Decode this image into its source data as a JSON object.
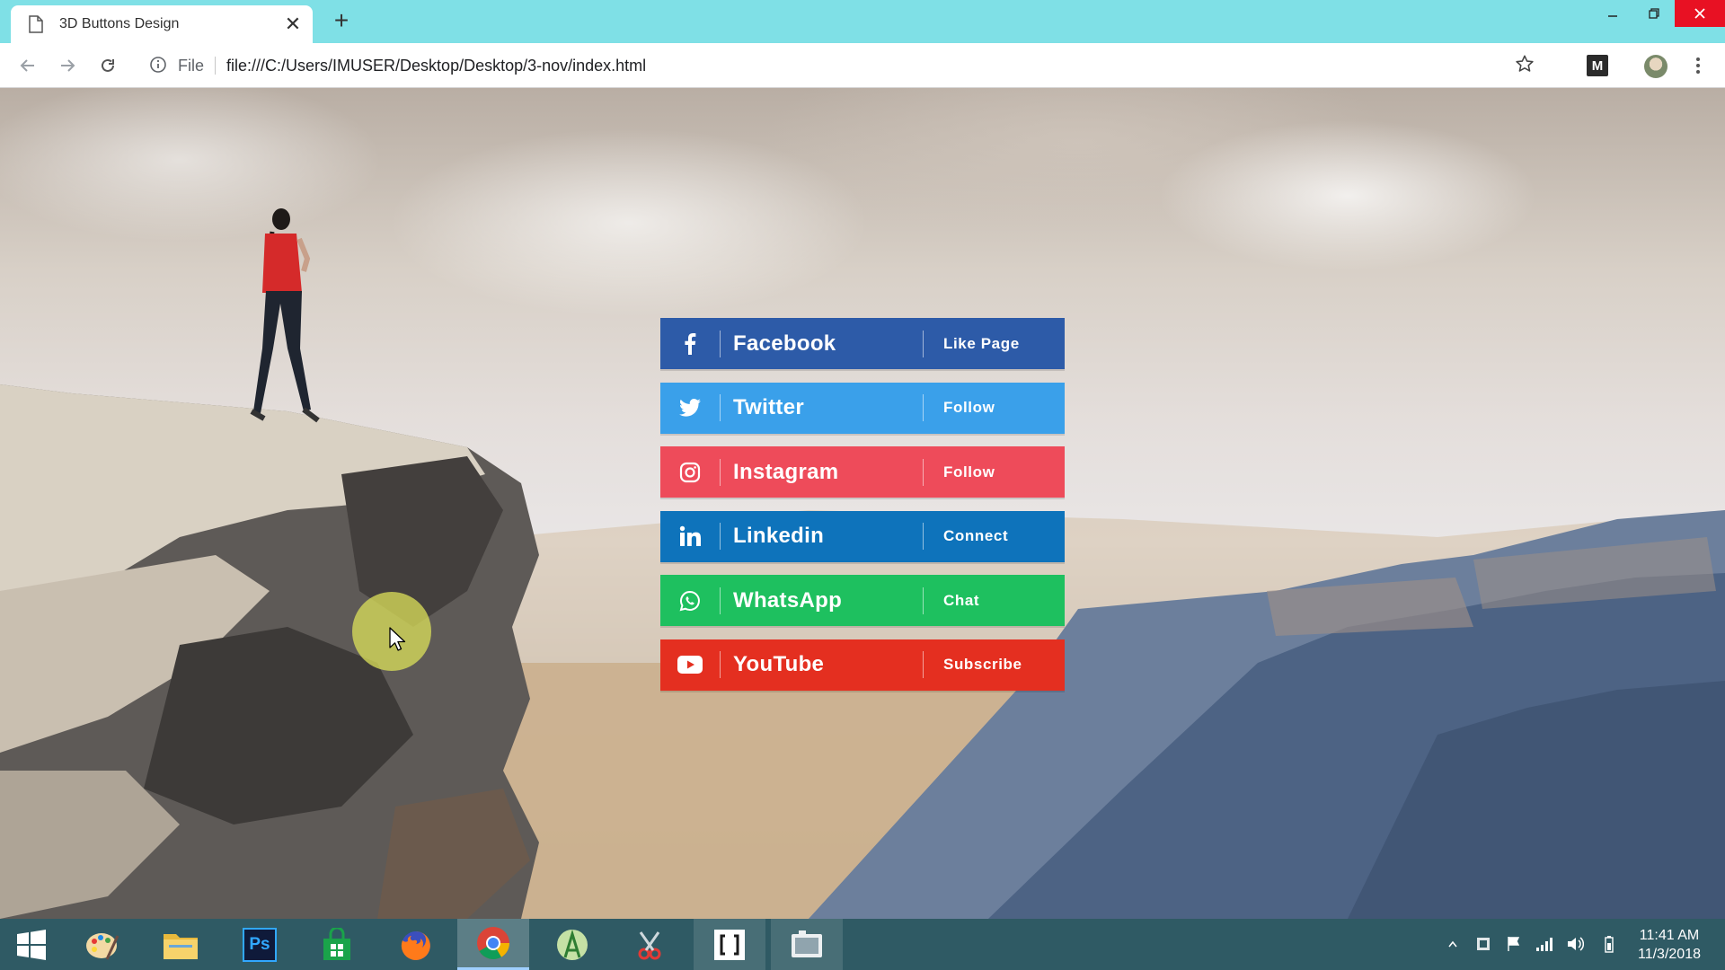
{
  "browser": {
    "tab_title": "3D Buttons Design",
    "tab_close": "✕",
    "new_tab": "+",
    "scheme_label": "File",
    "url": "file:///C:/Users/IMUSER/Desktop/Desktop/3-nov/index.html",
    "extension_label": "M"
  },
  "social_buttons": [
    {
      "icon": "facebook-icon",
      "name": "Facebook",
      "action": "Like Page",
      "color": "#2d5ba8"
    },
    {
      "icon": "twitter-icon",
      "name": "Twitter",
      "action": "Follow",
      "color": "#3aa0ea"
    },
    {
      "icon": "instagram-icon",
      "name": "Instagram",
      "action": "Follow",
      "color": "#ee4b5a"
    },
    {
      "icon": "linkedin-icon",
      "name": "Linkedin",
      "action": "Connect",
      "color": "#0e73bb"
    },
    {
      "icon": "whatsapp-icon",
      "name": "WhatsApp",
      "action": "Chat",
      "color": "#1ec05f"
    },
    {
      "icon": "youtube-icon",
      "name": "YouTube",
      "action": "Subscribe",
      "color": "#e42f20"
    }
  ],
  "taskbar": {
    "apps": [
      {
        "name": "paint-app",
        "state": "normal"
      },
      {
        "name": "file-explorer-app",
        "state": "normal"
      },
      {
        "name": "photoshop-app",
        "state": "normal",
        "label": "Ps"
      },
      {
        "name": "store-app",
        "state": "normal"
      },
      {
        "name": "firefox-app",
        "state": "normal"
      },
      {
        "name": "chrome-app",
        "state": "active"
      },
      {
        "name": "android-studio-app",
        "state": "normal"
      },
      {
        "name": "snipping-tool-app",
        "state": "normal"
      },
      {
        "name": "brackets-app",
        "state": "running"
      },
      {
        "name": "screen-recorder-app",
        "state": "running"
      }
    ],
    "time": "11:41 AM",
    "date": "11/3/2018"
  }
}
